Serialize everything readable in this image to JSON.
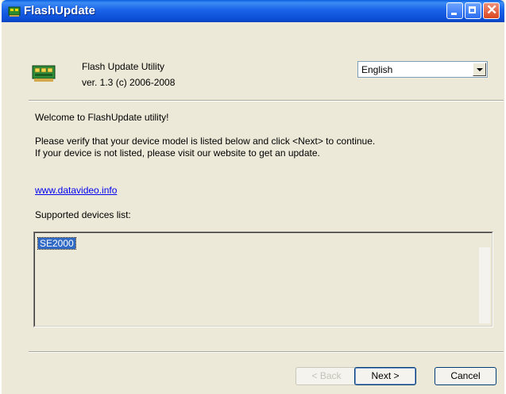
{
  "window": {
    "title": "FlashUpdate"
  },
  "header": {
    "app_name": "Flash Update Utility",
    "version": "ver. 1.3  (c) 2006-2008"
  },
  "language": {
    "selected": "English"
  },
  "body": {
    "welcome": "Welcome to FlashUpdate utility!",
    "instructions_line1": "Please verify that your device model is listed below and click <Next> to continue.",
    "instructions_line2": "If your device is not listed, please visit our website to get an update.",
    "website_link": "www.datavideo.info",
    "supported_label": "Supported devices list:",
    "devices": [
      "SE2000"
    ]
  },
  "buttons": {
    "back": "< Back",
    "next": "Next >",
    "cancel": "Cancel"
  }
}
